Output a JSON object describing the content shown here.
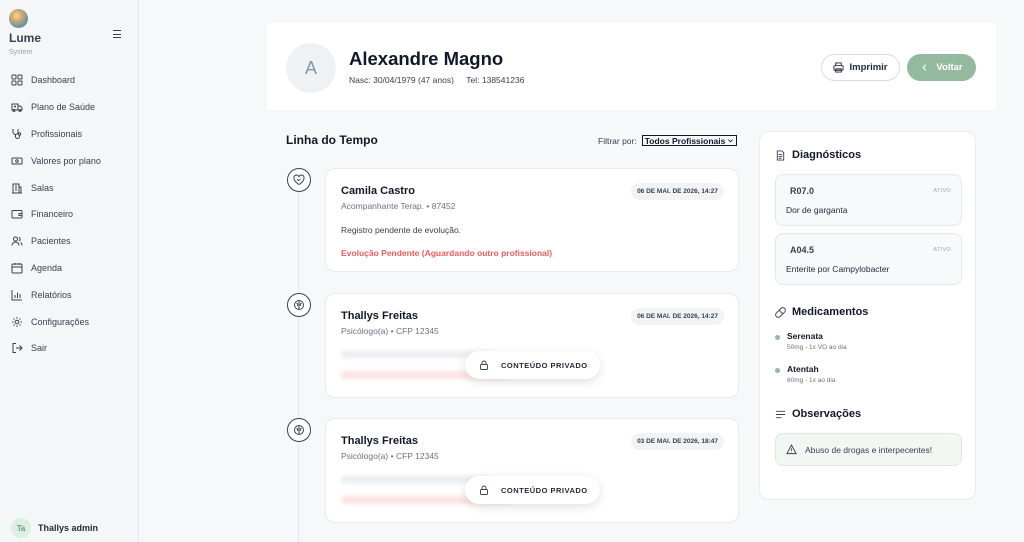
{
  "brand": {
    "name": "Lume",
    "subtitle": "System"
  },
  "sidebar": {
    "items": [
      {
        "label": "Dashboard",
        "icon": "dashboard-icon"
      },
      {
        "label": "Plano de Saúde",
        "icon": "ambulance-icon"
      },
      {
        "label": "Profissionais",
        "icon": "stethoscope-icon"
      },
      {
        "label": "Valores por plano",
        "icon": "banknote-icon"
      },
      {
        "label": "Salas",
        "icon": "building-icon"
      },
      {
        "label": "Financeiro",
        "icon": "wallet-icon"
      },
      {
        "label": "Pacientes",
        "icon": "users-icon"
      },
      {
        "label": "Agenda",
        "icon": "calendar-icon"
      },
      {
        "label": "Relatórios",
        "icon": "bar-chart-icon"
      },
      {
        "label": "Configurações",
        "icon": "gear-icon"
      },
      {
        "label": "Sair",
        "icon": "logout-icon"
      }
    ],
    "user": {
      "initials": "Ta",
      "name": "Thallys admin"
    }
  },
  "patient": {
    "initial": "A",
    "name": "Alexandre Magno",
    "birth": "Nasc: 30/04/1979 (47 anos)",
    "phone": "Tel: 138541236"
  },
  "actions": {
    "print_label": "Imprimir",
    "back_label": "Voltar"
  },
  "timeline": {
    "title": "Linha do Tempo",
    "filter_label": "Filtrar por:",
    "filter_value": "Todos Profissionais",
    "entries": [
      {
        "name": "Camila Castro",
        "role": "Acompanhante Terap. • 87452",
        "date": "06 DE MAI. DE 2026, 14:27",
        "text": "Registro pendente de evolução.",
        "status": "Evolução Pendente (Aguardando outro profissional)"
      },
      {
        "name": "Thallys Freitas",
        "role": "Psicólogo(a) • CFP 12345",
        "date": "06 DE MAI. DE 2026, 14:27",
        "private_label": "CONTEÚDO PRIVADO"
      },
      {
        "name": "Thallys Freitas",
        "role": "Psicólogo(a) • CFP 12345",
        "date": "03 DE MAI. DE 2026, 18:47",
        "private_label": "CONTEÚDO PRIVADO"
      }
    ]
  },
  "diagnostics": {
    "title": "Diagnósticos",
    "items": [
      {
        "code": "R07.0",
        "status": "ATIVO",
        "description": "Dor de garganta"
      },
      {
        "code": "A04.5",
        "status": "ATIVO",
        "description": "Enterite por Campylobacter"
      }
    ]
  },
  "medications": {
    "title": "Medicamentos",
    "items": [
      {
        "name": "Serenata",
        "dose": "50mg - 1x VO ao dia"
      },
      {
        "name": "Atentah",
        "dose": "60mg - 1x ao dia"
      }
    ]
  },
  "observations": {
    "title": "Observações",
    "text": "Abuso de drogas e interpecentes!"
  },
  "colors": {
    "accent": "#93b99f",
    "pending": "#ef5b5b"
  }
}
